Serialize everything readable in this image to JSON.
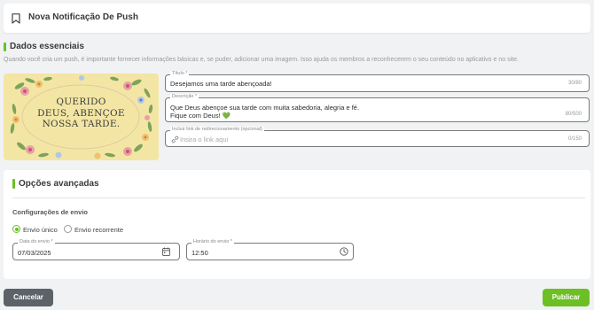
{
  "header": {
    "title": "Nova Notificação De Push",
    "icon": "bookmark-icon"
  },
  "essentials": {
    "title": "Dados essenciais",
    "description": "Quando você cria um push, é importante fornecer informações básicas e, se puder, adicionar uma imagem. Isso ajuda os membros a reconhecerem o seu conteúdo no aplicativo e no site.",
    "image_caption": [
      "QUERIDO",
      "DEUS, ABENÇOE",
      "NOSSA TARDE."
    ],
    "title_field": {
      "label": "Título *",
      "value": "Desejamos uma tarde abençoada!",
      "count": "30/80"
    },
    "description_field": {
      "label": "Descrição *",
      "line1": "Que Deus abençoe sua tarde com muita sabedoria, alegria e fé.",
      "line2": "Fique com Deus!",
      "emoji": "💚",
      "count": "80/500"
    },
    "link_field": {
      "label": "Incluir link de redirecionamento (opcional)",
      "placeholder": "Insira o link aqui",
      "count": "0/150"
    }
  },
  "advanced": {
    "title": "Opções avançadas",
    "config_title": "Configurações de envio",
    "options": [
      {
        "label": "Envio único",
        "selected": true
      },
      {
        "label": "Envio recorrente",
        "selected": false
      }
    ],
    "date_field": {
      "label": "Data do envio *",
      "value": "07/03/2025"
    },
    "time_field": {
      "label": "Horário do envio *",
      "value": "12:50"
    }
  },
  "actions": {
    "cancel": "Cancelar",
    "publish": "Publicar"
  },
  "colors": {
    "accent": "#6cc024",
    "cancel": "#5d6268"
  }
}
